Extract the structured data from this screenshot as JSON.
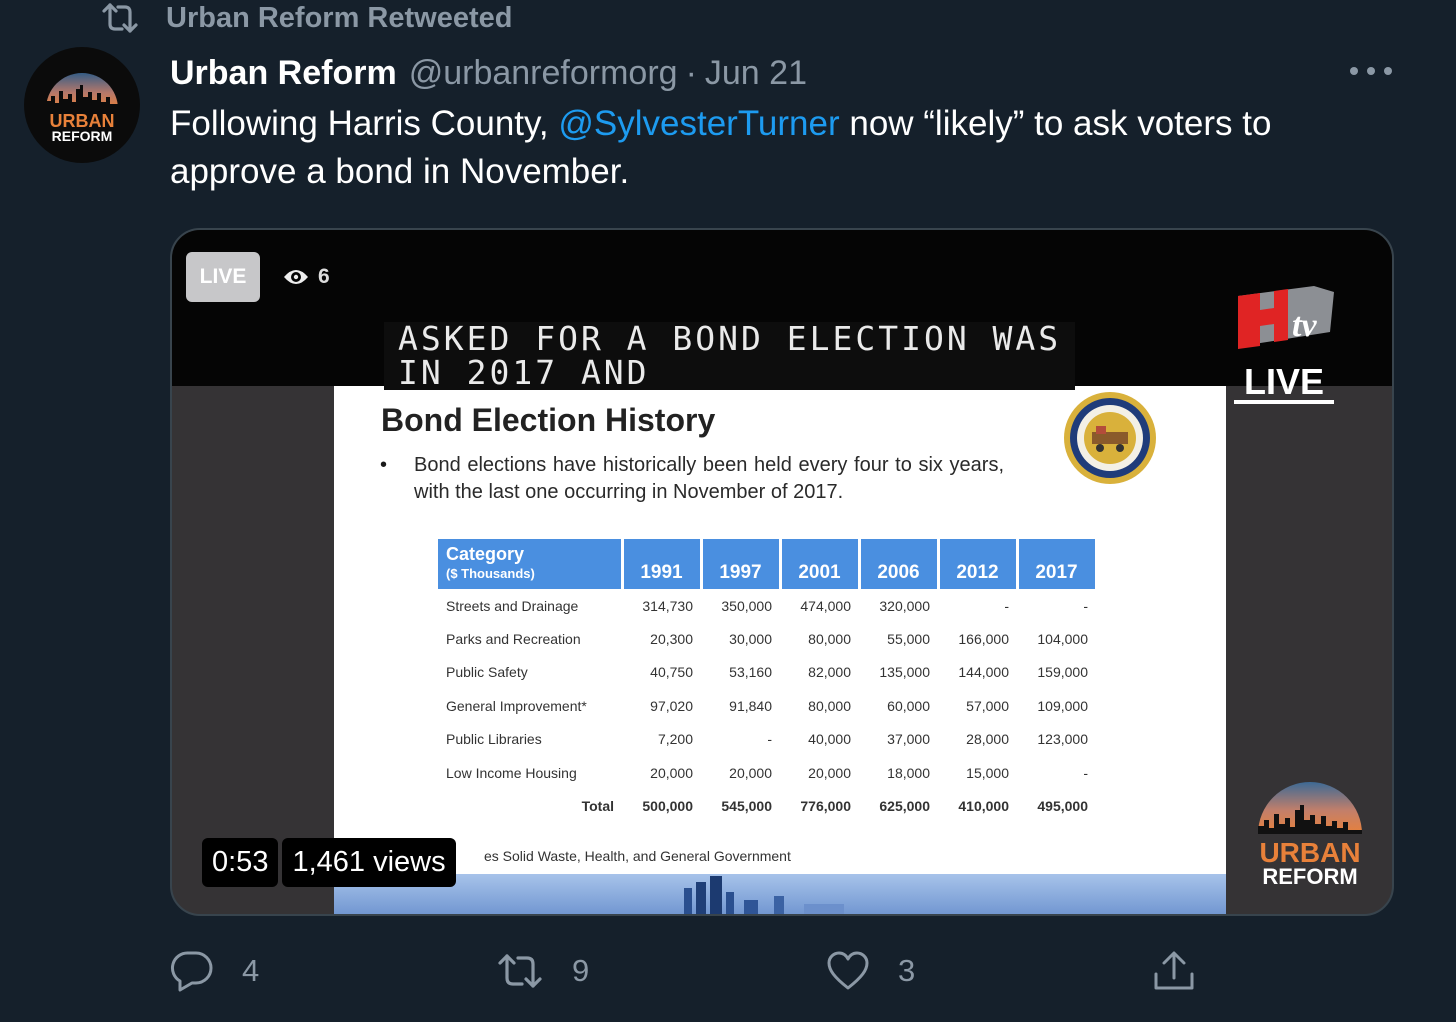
{
  "retweet": {
    "label": "Urban Reform Retweeted"
  },
  "avatar": {
    "line1": "URBAN",
    "line2": "REFORM"
  },
  "tweet": {
    "name": "Urban Reform",
    "handle": "@urbanreformorg",
    "separator": "·",
    "date": "Jun 21",
    "text_before": "Following Harris County, ",
    "mention": "@SylvesterTurner",
    "text_after": " now “likely” to ask voters to approve a bond in November."
  },
  "video": {
    "live_badge": "LIVE",
    "viewer_count": "6",
    "caption_line1": "ASKED FOR A BOND ELECTION WAS",
    "caption_line2": "IN 2017 AND",
    "htv_live": "LIVE",
    "timestamp": "0:53",
    "views": "1,461 views",
    "watermark": {
      "line1": "URBAN",
      "line2": "REFORM"
    }
  },
  "slide": {
    "title": "Bond Election History",
    "bullet_marker": "•",
    "bullet": "Bond elections have historically been held every four to six years, with the last one occurring in November of 2017.",
    "table": {
      "header_category": "Category",
      "header_unit": "($ Thousands)",
      "years": [
        "1991",
        "1997",
        "2001",
        "2006",
        "2012",
        "2017"
      ],
      "rows": [
        {
          "label": "Streets and Drainage",
          "values": [
            "314,730",
            "350,000",
            "474,000",
            "320,000",
            "-",
            "-"
          ]
        },
        {
          "label": "Parks and Recreation",
          "values": [
            "20,300",
            "30,000",
            "80,000",
            "55,000",
            "166,000",
            "104,000"
          ]
        },
        {
          "label": "Public Safety",
          "values": [
            "40,750",
            "53,160",
            "82,000",
            "135,000",
            "144,000",
            "159,000"
          ]
        },
        {
          "label": "General Improvement*",
          "values": [
            "97,020",
            "91,840",
            "80,000",
            "60,000",
            "57,000",
            "109,000"
          ]
        },
        {
          "label": "Public Libraries",
          "values": [
            "7,200",
            "-",
            "40,000",
            "37,000",
            "28,000",
            "123,000"
          ]
        },
        {
          "label": "Low Income Housing",
          "values": [
            "20,000",
            "20,000",
            "20,000",
            "18,000",
            "15,000",
            "-"
          ]
        }
      ],
      "total": {
        "label": "Total",
        "values": [
          "500,000",
          "545,000",
          "776,000",
          "625,000",
          "410,000",
          "495,000"
        ]
      }
    },
    "footnote": "es Solid Waste, Health, and General Government"
  },
  "actions": {
    "reply_count": "4",
    "retweet_count": "9",
    "like_count": "3"
  },
  "colors": {
    "background": "#15202b",
    "secondary_text": "#8b98a5",
    "link": "#1d9bf0",
    "table_header": "#4a8fe0"
  },
  "icons": [
    "retweet-icon",
    "more-icon",
    "eye-icon",
    "reply-icon",
    "like-icon",
    "share-icon"
  ]
}
